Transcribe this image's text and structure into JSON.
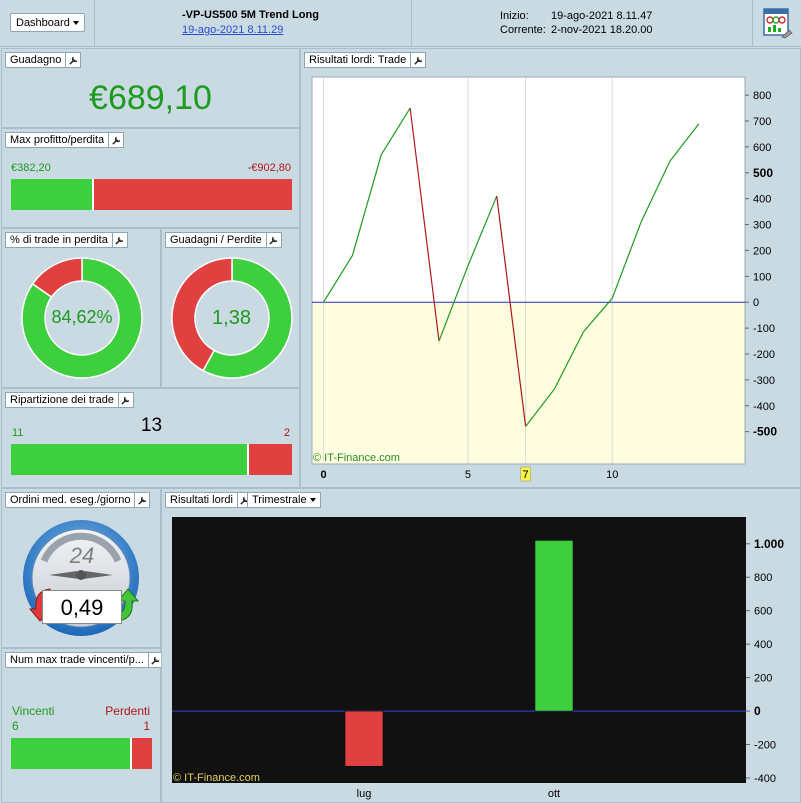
{
  "header": {
    "dashboard_label": "Dashboard",
    "system_name": "-VP-US500 5M Trend Long",
    "system_date": "19-ago-2021 8.11.29",
    "start_label": "Inizio:",
    "start_value": "19-ago-2021 8.11.47",
    "current_label": "Corrente:",
    "current_value": "2-nov-2021 18.20.00"
  },
  "gain": {
    "title": "Guadagno",
    "value": "€689,10"
  },
  "max_pl": {
    "title": "Max profitto/perdita",
    "profit": "€382,20",
    "loss": "-€902,80",
    "profit_fraction": 0.297
  },
  "loss_pct": {
    "title": "% di trade in perdita",
    "value": "84,62%",
    "green_fraction": 0.8462
  },
  "gain_loss": {
    "title": "Guadagni / Perdite",
    "value": "1,38",
    "green_fraction": 0.58
  },
  "trade_split": {
    "title": "Ripartizione dei trade",
    "total": "13",
    "winners": "11",
    "losers": "2",
    "win_fraction": 0.846
  },
  "avg_orders": {
    "title": "Ordini med. eseg./giorno",
    "dial_number": "24",
    "value": "0,49"
  },
  "max_wins": {
    "title": "Num max trade vincenti/p...",
    "win_label": "Vincenti",
    "loss_label": "Perdenti",
    "win_value": "6",
    "loss_value": "1",
    "win_fraction": 0.86
  },
  "trade_chart": {
    "title": "Risultati lordi: Trade",
    "watermark": "© IT-Finance.com",
    "highlight_tick": "7"
  },
  "quarter_chart": {
    "title": "Risultati lordi",
    "period_label": "Trimestrale",
    "watermark": "© IT-Finance.com"
  },
  "chart_data": [
    {
      "type": "line",
      "title": "Risultati lordi: Trade",
      "x": [
        0,
        1,
        2,
        3,
        4,
        5,
        6,
        7,
        8,
        9,
        10,
        11,
        12,
        13
      ],
      "y": [
        0,
        180,
        570,
        750,
        -150,
        140,
        410,
        -480,
        -335,
        -115,
        15,
        310,
        545,
        689
      ],
      "xlim": [
        -0.4,
        14.6
      ],
      "ylim": [
        -625,
        870
      ],
      "x_ticks": [
        "0",
        "5",
        "7",
        "10"
      ],
      "x_tick_values": [
        0,
        5,
        7,
        10
      ],
      "y_ticks": [
        "800",
        "700",
        "600",
        "500",
        "400",
        "300",
        "200",
        "100",
        "0",
        "-100",
        "-200",
        "-300",
        "-400",
        "-500"
      ],
      "y_tick_values": [
        800,
        700,
        600,
        500,
        400,
        300,
        200,
        100,
        0,
        -100,
        -200,
        -300,
        -400,
        -500
      ],
      "colors": {
        "up": "#1e9a1e",
        "down": "#b01818",
        "zero": "#2233bb"
      }
    },
    {
      "type": "bar",
      "title": "Risultati lordi",
      "categories": [
        "lug",
        "ott"
      ],
      "values": [
        -330,
        1020
      ],
      "ylim": [
        -430,
        1160
      ],
      "y_ticks": [
        "1.000",
        "800",
        "600",
        "400",
        "200",
        "0",
        "-200",
        "-400"
      ],
      "y_tick_values": [
        1000,
        800,
        600,
        400,
        200,
        0,
        -200,
        -400
      ],
      "colors": {
        "positive": "#3ecf3e",
        "negative": "#e04040"
      }
    }
  ]
}
